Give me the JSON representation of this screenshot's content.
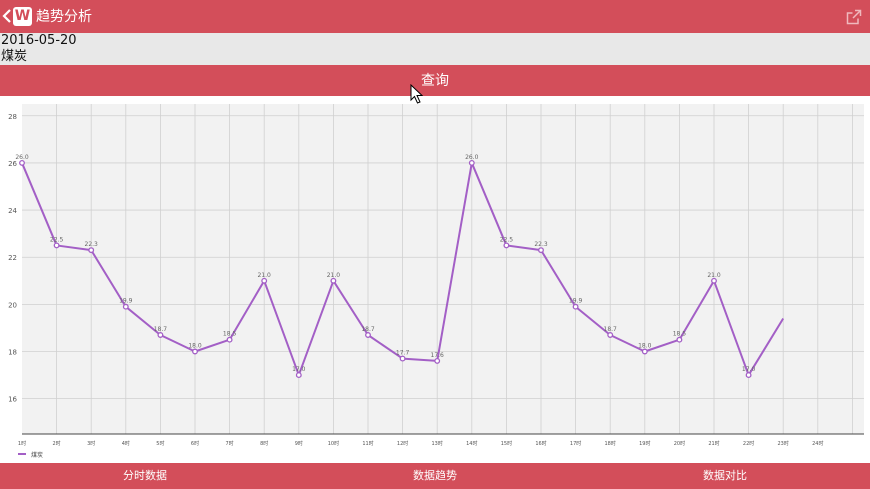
{
  "header": {
    "back_icon": "chevron-left-icon",
    "logo_text": "W",
    "title": "趋势分析",
    "share_icon": "external-link-icon"
  },
  "info": {
    "date": "2016-05-20",
    "product": "煤炭"
  },
  "query_button": {
    "label": "查询"
  },
  "tabs": [
    {
      "label": "分时数据"
    },
    {
      "label": "数据趋势"
    },
    {
      "label": "数据对比"
    }
  ],
  "colors": {
    "accent": "#d34e5a",
    "series": "#a35fc6",
    "plot_bg": "#f2f2f2",
    "grid": "#d0d0d0"
  },
  "chart_data": {
    "type": "line",
    "x": [
      "1时",
      "2时",
      "3时",
      "4时",
      "5时",
      "6时",
      "7时",
      "8时",
      "9时",
      "10时",
      "11时",
      "12时",
      "13时",
      "14时",
      "15时",
      "16时",
      "17时",
      "18时",
      "19时",
      "20时",
      "21时",
      "22时",
      "23时",
      "24时"
    ],
    "series": [
      {
        "name": "煤炭",
        "values": [
          26.0,
          22.5,
          22.3,
          19.9,
          18.7,
          18.0,
          18.5,
          21.0,
          17.0,
          21.0,
          18.7,
          17.7,
          17.6,
          26.0,
          22.5,
          22.3,
          19.9,
          18.7,
          18.0,
          18.5,
          21.0,
          17.0,
          19.4,
          null
        ]
      }
    ],
    "data_labels": [
      "26.0",
      "22.5",
      "22.3",
      "19.9",
      "18.7",
      "18.0",
      "18.5",
      "21.0",
      "17.0",
      "21.0",
      "18.7",
      "17.7",
      "17.6",
      "26.0",
      "22.5",
      "22.3",
      "19.9",
      "18.7",
      "18.0",
      "18.5",
      "21.0",
      "17.0",
      "",
      ""
    ],
    "y_ticks": [
      "16",
      "18",
      "20",
      "22",
      "24",
      "26",
      "28"
    ],
    "ylim": [
      14.5,
      28.5
    ],
    "grid": true,
    "legend_position": "bottom-left",
    "title": "",
    "xlabel": "",
    "ylabel": ""
  }
}
